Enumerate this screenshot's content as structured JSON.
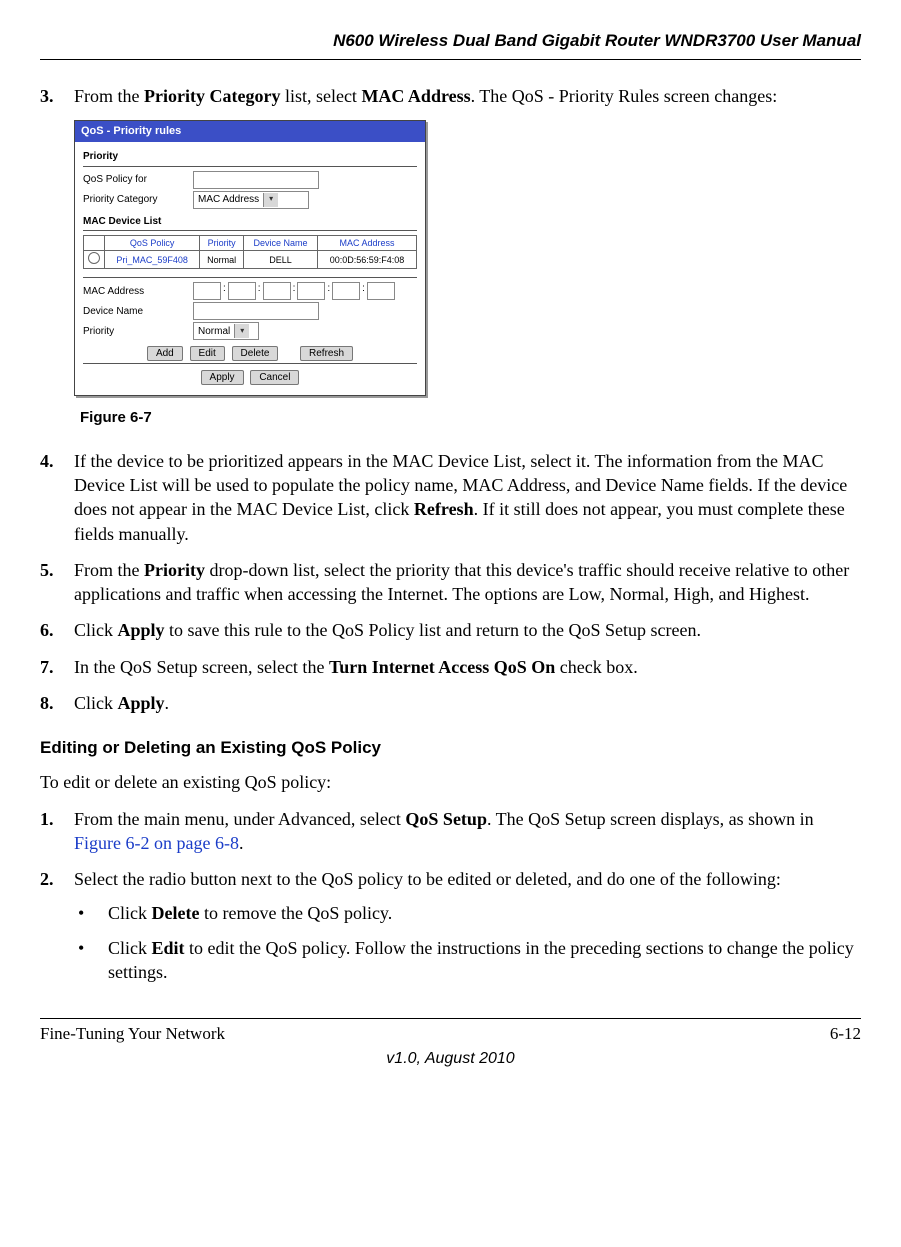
{
  "header": {
    "title": "N600 Wireless Dual Band Gigabit Router WNDR3700 User Manual"
  },
  "step3": {
    "num": "3.",
    "pre": "From the ",
    "b1": "Priority Category",
    "mid": " list, select ",
    "b2": "MAC Address",
    "post": ". The QoS - Priority Rules screen changes:"
  },
  "shot": {
    "title": "QoS - Priority rules",
    "sect_priority": "Priority",
    "lbl_policy_for": "QoS Policy for",
    "lbl_category": "Priority Category",
    "sel_category": "MAC Address",
    "sect_devlist": "MAC Device List",
    "th_policy": "QoS Policy",
    "th_priority": "Priority",
    "th_devname": "Device Name",
    "th_mac": "MAC Address",
    "row_policy": "Pri_MAC_59F408",
    "row_priority": "Normal",
    "row_devname": "DELL",
    "row_mac": "00:0D:56:59:F4:08",
    "lbl_mac": "MAC Address",
    "lbl_devname": "Device Name",
    "lbl_priority": "Priority",
    "sel_priority": "Normal",
    "btn_add": "Add",
    "btn_edit": "Edit",
    "btn_delete": "Delete",
    "btn_refresh": "Refresh",
    "btn_apply": "Apply",
    "btn_cancel": "Cancel",
    "colon": ":"
  },
  "figcap": "Figure 6-7",
  "step4": {
    "num": "4.",
    "t1": "If the device to be prioritized appears in the MAC Device List, select it. The information from the MAC Device List will be used to populate the policy name, MAC Address, and Device Name fields. If the device does not appear in the MAC Device List, click ",
    "b1": "Refresh",
    "t2": ". If it still does not appear, you must complete these fields manually."
  },
  "step5": {
    "num": "5.",
    "t1": "From the ",
    "b1": "Priority",
    "t2": " drop-down list, select the priority that this device's traffic should receive relative to other applications and traffic when accessing the Internet. The options are Low, Normal, High, and Highest."
  },
  "step6": {
    "num": "6.",
    "t1": "Click ",
    "b1": "Apply",
    "t2": " to save this rule to the QoS Policy list and return to the QoS Setup screen."
  },
  "step7": {
    "num": "7.",
    "t1": "In the QoS Setup screen, select the ",
    "b1": "Turn Internet Access QoS On",
    "t2": " check box."
  },
  "step8": {
    "num": "8.",
    "t1": "Click ",
    "b1": "Apply",
    "t2": "."
  },
  "subheading": "Editing or Deleting an Existing QoS Policy",
  "intro": "To edit or delete an existing QoS policy:",
  "e_step1": {
    "num": "1.",
    "t1": "From the main menu, under Advanced, select ",
    "b1": "QoS Setup",
    "t2": ". The QoS Setup screen displays, as shown in ",
    "link": "Figure 6-2 on page 6-8",
    "t3": "."
  },
  "e_step2": {
    "num": "2.",
    "t1": "Select the radio button next to the QoS policy to be edited or deleted, and do one of the following:"
  },
  "bul1": {
    "dot": "•",
    "t1": "Click ",
    "b1": "Delete",
    "t2": " to remove the QoS policy."
  },
  "bul2": {
    "dot": "•",
    "t1": "Click ",
    "b1": "Edit",
    "t2": " to edit the QoS policy. Follow the instructions in the preceding sections to change the policy settings."
  },
  "footer": {
    "left": "Fine-Tuning Your Network",
    "right": "6-12",
    "center": "v1.0, August 2010"
  }
}
